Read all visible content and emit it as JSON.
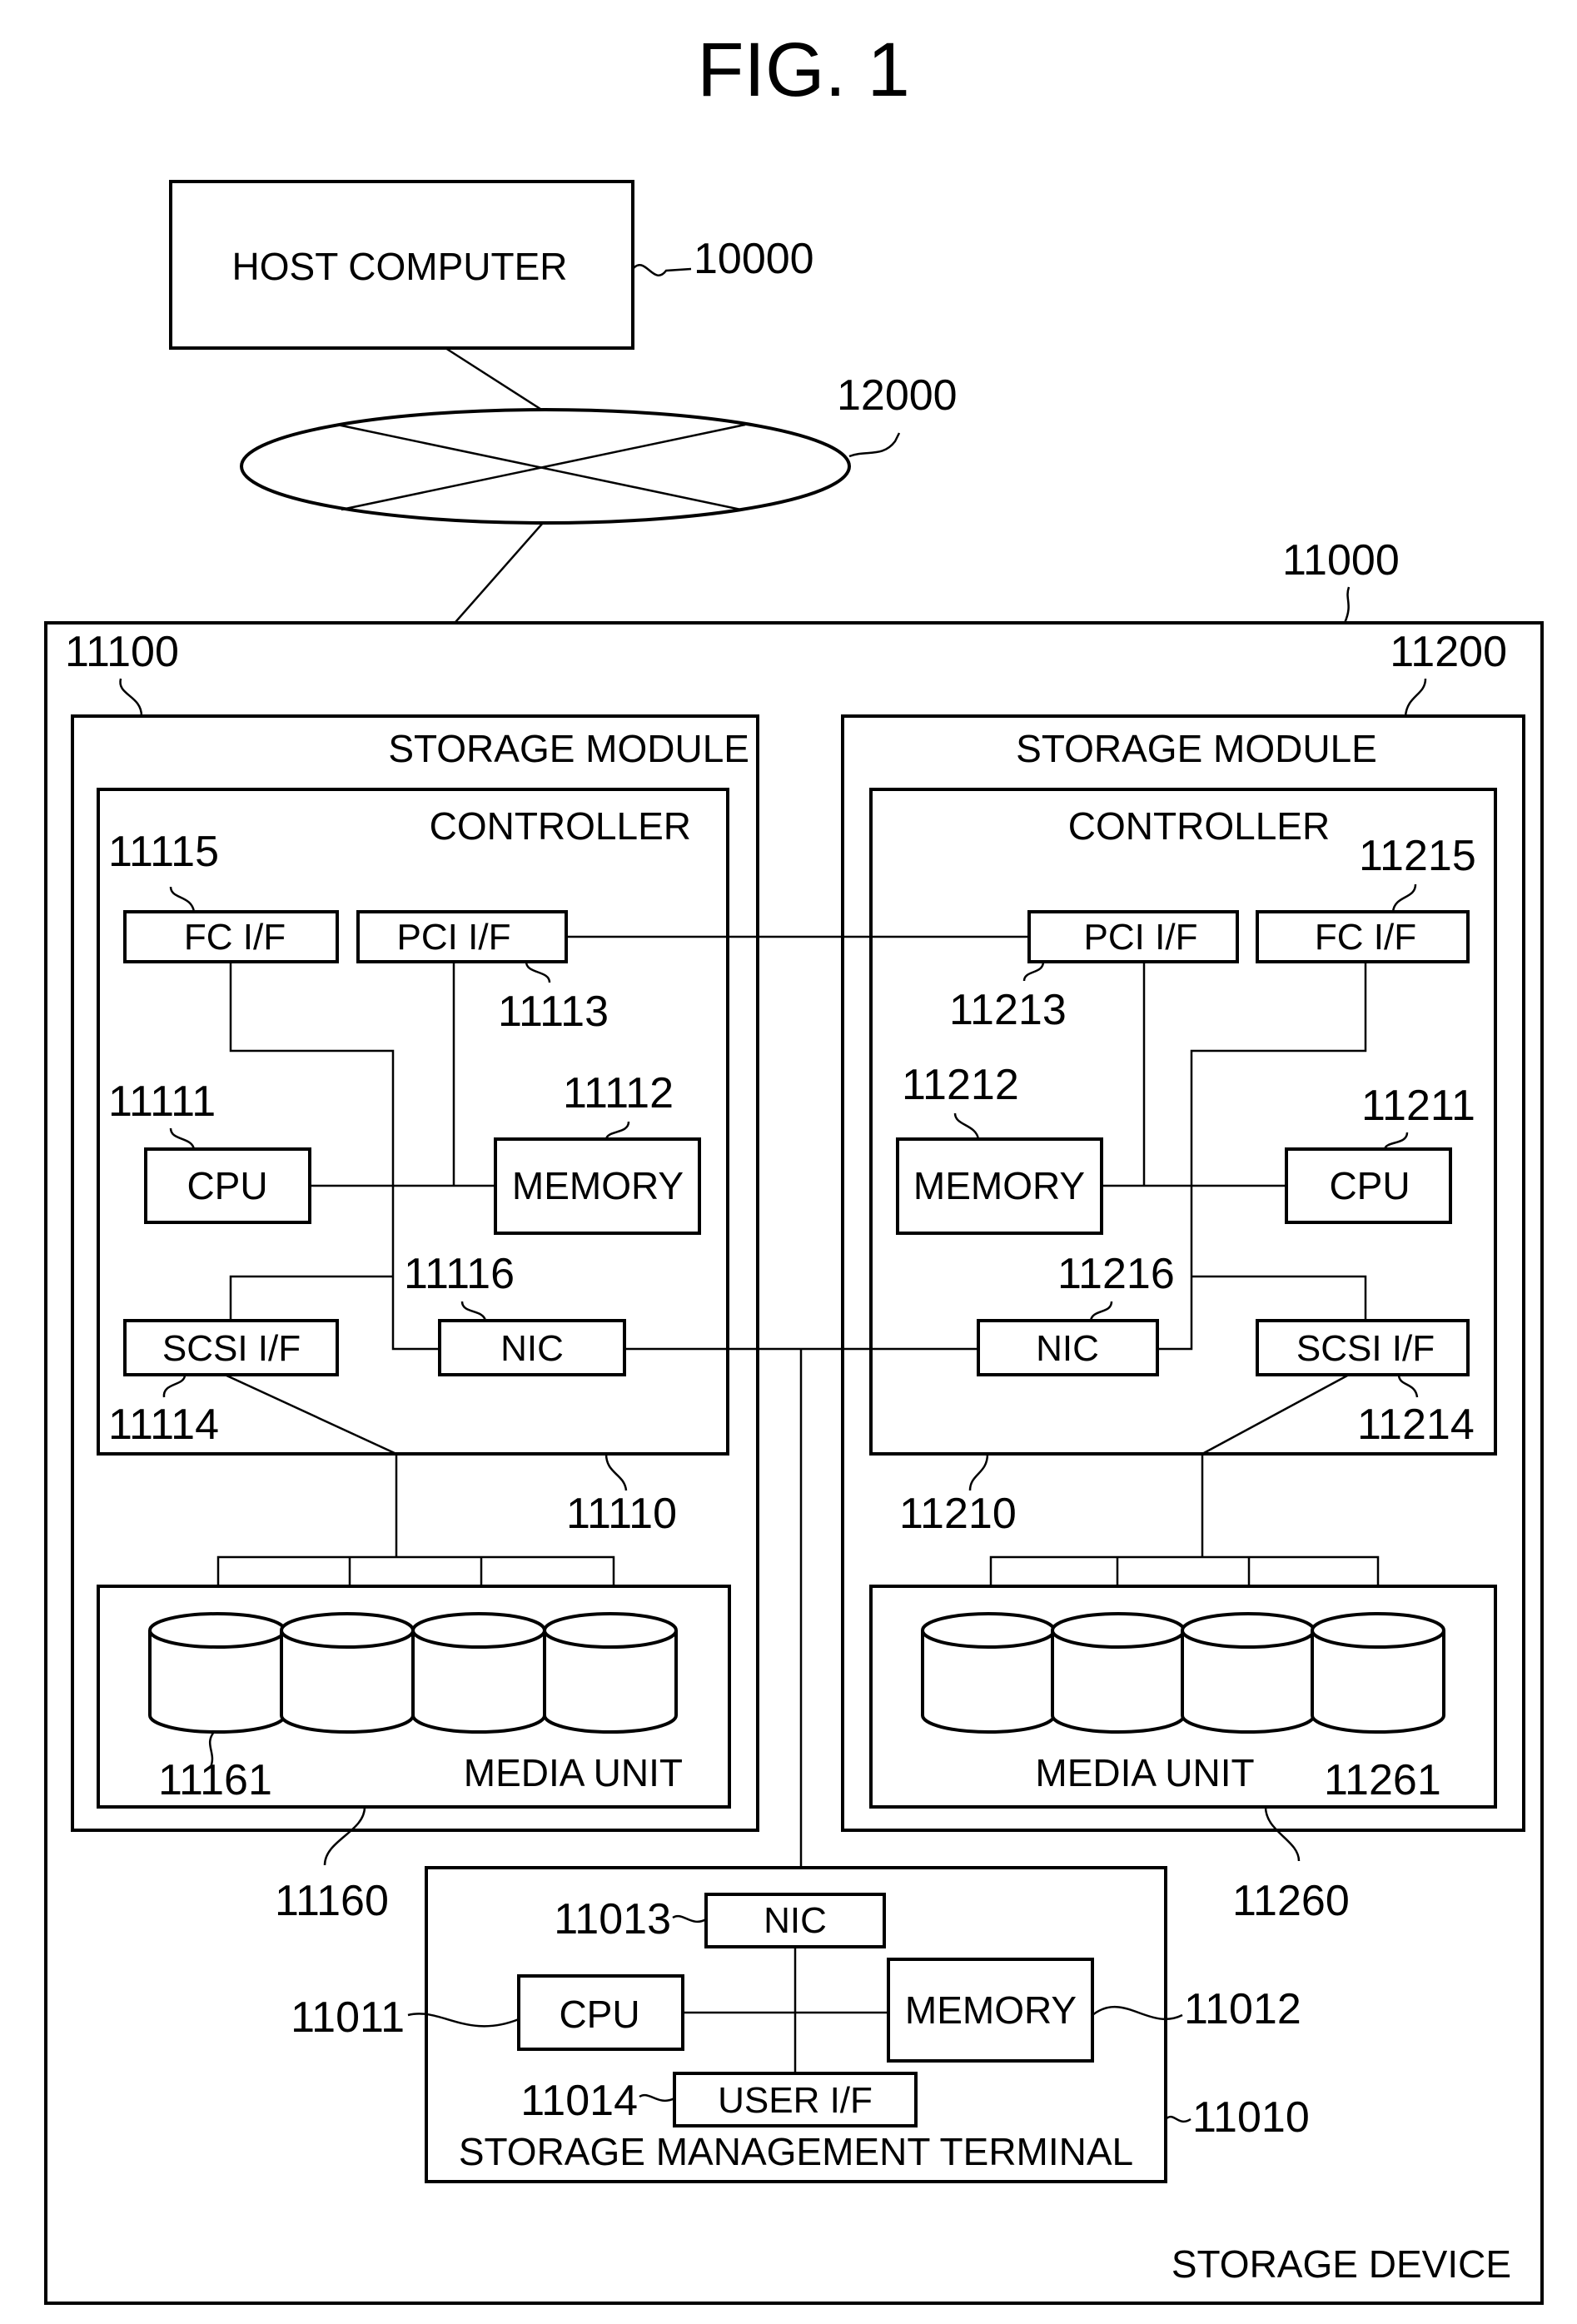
{
  "figure": {
    "title": "FIG. 1",
    "host": {
      "label": "HOST COMPUTER",
      "ref": "10000"
    },
    "network": {
      "ref": "12000"
    },
    "storage_device": {
      "label": "STORAGE DEVICE",
      "ref": "11000",
      "modules": [
        {
          "ref": "11100",
          "label": "STORAGE MODULE",
          "controller": {
            "label": "CONTROLLER",
            "ref": "11110",
            "fc_if": {
              "label": "FC I/F",
              "ref": "11115"
            },
            "pci_if": {
              "label": "PCI I/F",
              "ref": "11113"
            },
            "cpu": {
              "label": "CPU",
              "ref": "11111"
            },
            "memory": {
              "label": "MEMORY",
              "ref": "11112"
            },
            "scsi_if": {
              "label": "SCSI I/F",
              "ref": "11114"
            },
            "nic": {
              "label": "NIC",
              "ref": "11116"
            }
          },
          "media_unit": {
            "label": "MEDIA UNIT",
            "ref": "11160",
            "media_ref": "11161",
            "disk_count": 4
          }
        },
        {
          "ref": "11200",
          "label": "STORAGE MODULE",
          "controller": {
            "label": "CONTROLLER",
            "ref": "11210",
            "fc_if": {
              "label": "FC I/F",
              "ref": "11215"
            },
            "pci_if": {
              "label": "PCI I/F",
              "ref": "11213"
            },
            "cpu": {
              "label": "CPU",
              "ref": "11211"
            },
            "memory": {
              "label": "MEMORY",
              "ref": "11212"
            },
            "scsi_if": {
              "label": "SCSI I/F",
              "ref": "11214"
            },
            "nic": {
              "label": "NIC",
              "ref": "11216"
            }
          },
          "media_unit": {
            "label": "MEDIA UNIT",
            "ref": "11260",
            "media_ref": "11261",
            "disk_count": 4
          }
        }
      ],
      "management_terminal": {
        "label": "STORAGE MANAGEMENT TERMINAL",
        "ref": "11010",
        "nic": {
          "label": "NIC",
          "ref": "11013"
        },
        "cpu": {
          "label": "CPU",
          "ref": "11011"
        },
        "memory": {
          "label": "MEMORY",
          "ref": "11012"
        },
        "user_if": {
          "label": "USER I/F",
          "ref": "11014"
        }
      }
    }
  }
}
